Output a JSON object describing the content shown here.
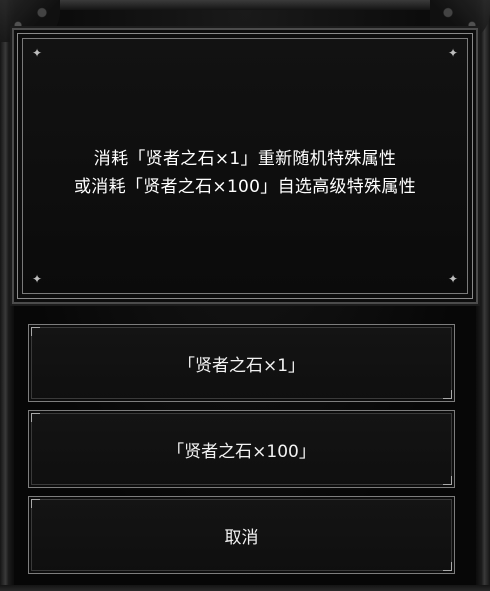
{
  "dialog": {
    "message_line1": "消耗「贤者之石×1」重新随机特殊属性",
    "message_line2": "或消耗「贤者之石×100」自选高级特殊属性"
  },
  "options": [
    {
      "label": "「贤者之石×1」"
    },
    {
      "label": "「贤者之石×100」"
    },
    {
      "label": "取消"
    }
  ],
  "colors": {
    "background": "#070707",
    "panel": "#0d0d0d",
    "border": "#7d7d7d",
    "text": "#ffffff"
  },
  "icons": [
    "sparkle-icon"
  ]
}
